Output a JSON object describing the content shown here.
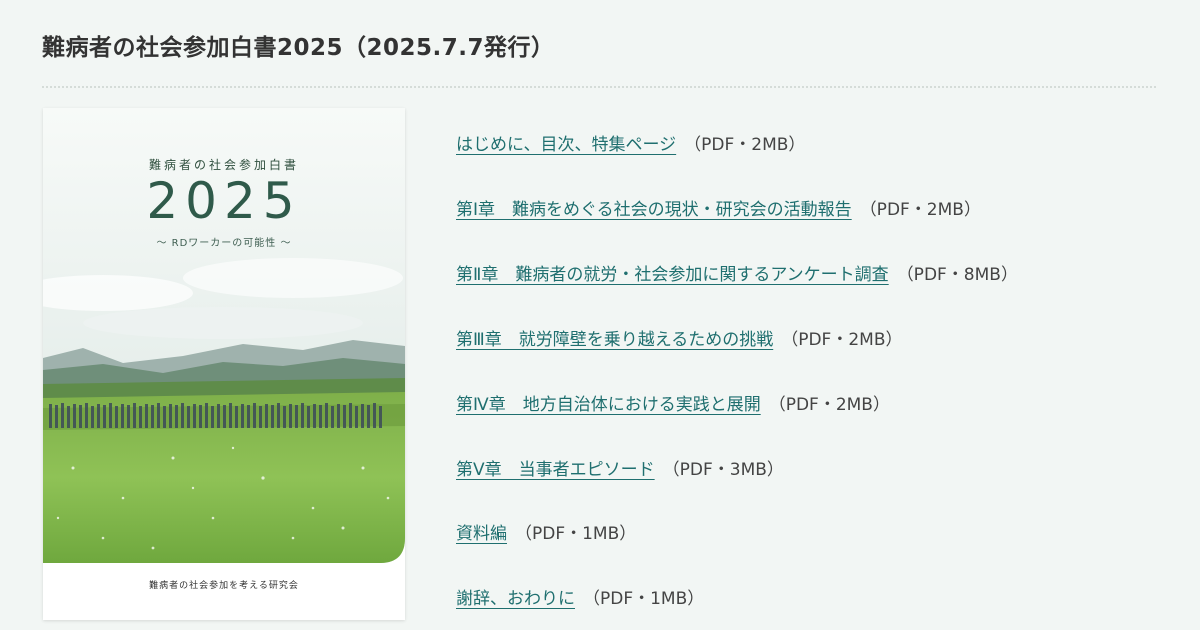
{
  "page": {
    "title": "難病者の社会参加白書2025（2025.7.7発行）"
  },
  "cover": {
    "label": "難病者の社会参加白書",
    "year": "2025",
    "subtitle": "～ RDワーカーの可能性 ～",
    "publisher": "難病者の社会参加を考える研究会"
  },
  "documents": [
    {
      "title": "はじめに、目次、特集ページ",
      "meta": "（PDF・2MB）"
    },
    {
      "title": "第Ⅰ章　難病をめぐる社会の現状・研究会の活動報告",
      "meta": "（PDF・2MB）"
    },
    {
      "title": "第Ⅱ章　難病者の就労・社会参加に関するアンケート調査",
      "meta": "（PDF・8MB）"
    },
    {
      "title": "第Ⅲ章　就労障壁を乗り越えるための挑戦",
      "meta": "（PDF・2MB）"
    },
    {
      "title": "第Ⅳ章　地方自治体における実践と展開",
      "meta": "（PDF・2MB）"
    },
    {
      "title": "第Ⅴ章　当事者エピソード",
      "meta": "（PDF・3MB）"
    },
    {
      "title": "資料編",
      "meta": "（PDF・1MB）"
    },
    {
      "title": "謝辞、おわりに",
      "meta": "（PDF・1MB）"
    }
  ],
  "colors": {
    "background": "#f2f6f4",
    "link": "#1f6f6f",
    "cover_text": "#2f5a4a",
    "meadow": "#8cbf4f"
  }
}
